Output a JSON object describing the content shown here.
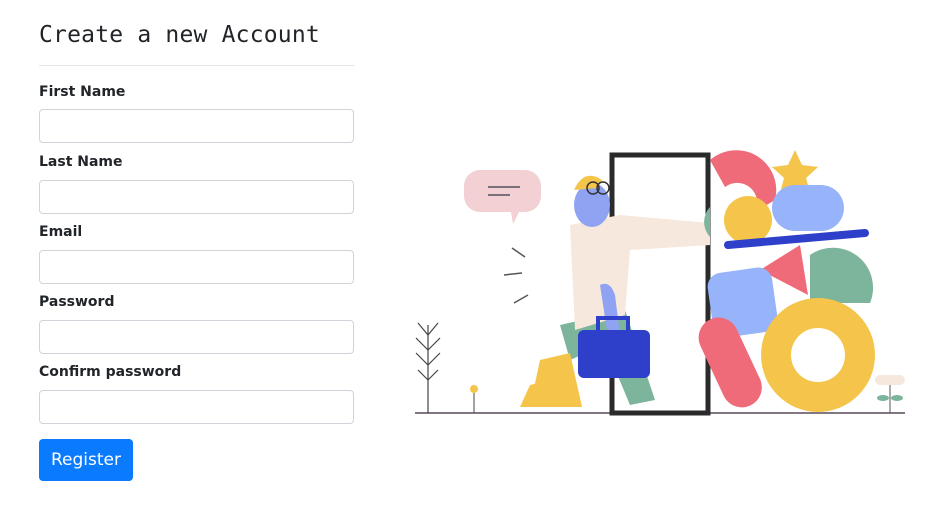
{
  "form": {
    "title": "Create a new Account",
    "fields": [
      {
        "label": "First Name",
        "value": "",
        "placeholder": ""
      },
      {
        "label": "Last Name",
        "value": "",
        "placeholder": ""
      },
      {
        "label": "Email",
        "value": "",
        "placeholder": ""
      },
      {
        "label": "Password",
        "value": "",
        "placeholder": ""
      },
      {
        "label": "Confirm password",
        "value": "",
        "placeholder": ""
      }
    ],
    "submit_label": "Register"
  },
  "colors": {
    "primary_button": "#0a7bff",
    "input_border": "#ced4da"
  },
  "illustration": {
    "icon": "person-walking-through-door-with-shapes"
  }
}
